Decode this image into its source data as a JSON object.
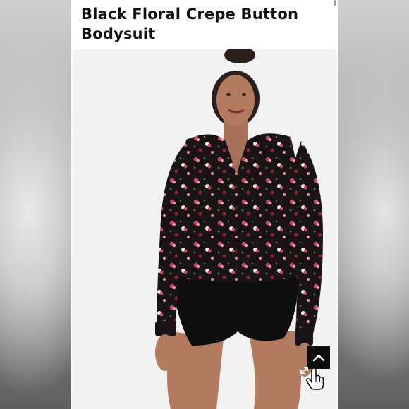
{
  "product": {
    "title": "Black Floral Crepe Button Bodysuit"
  },
  "photo": {
    "background_color": "#f2f2f2",
    "top_color": "#1a1417",
    "print_colors": [
      "#c8506a",
      "#e59aa8",
      "#f3eee4",
      "#8a2236"
    ],
    "bottom_color": "#0e0e0e"
  },
  "controls": {
    "scroll_top_icon": "chevron-up-icon",
    "expand_icon": "expand-arrows-icon",
    "cursor_icon": "hand-pointer-icon"
  }
}
